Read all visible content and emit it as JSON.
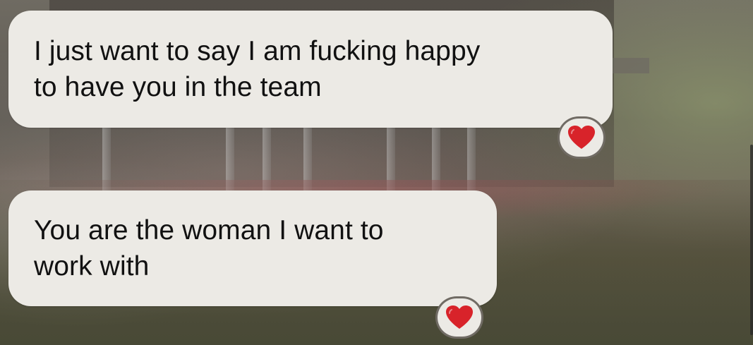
{
  "messages": [
    {
      "text": "I just want to say I am fucking happy\nto have you in the team",
      "reaction": {
        "icon": "red-heart-icon",
        "emoji": "❤️"
      }
    },
    {
      "text": "You are the woman I want to\nwork with",
      "reaction": {
        "icon": "red-heart-icon",
        "emoji": "❤️"
      }
    }
  ],
  "colors": {
    "bubble": "#eceae5",
    "text": "#111111",
    "heart": "#d8232a"
  }
}
